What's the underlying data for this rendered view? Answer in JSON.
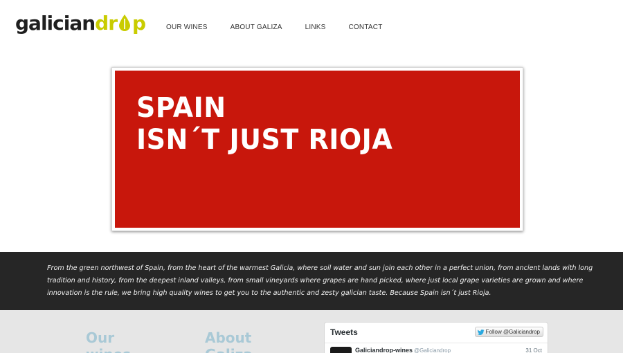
{
  "header": {
    "logo_text_a": "galician",
    "logo_text_b": "dr",
    "logo_text_c": "p",
    "nav": [
      {
        "label": "OUR WINES"
      },
      {
        "label": "ABOUT GALIZA"
      },
      {
        "label": "LINKS"
      },
      {
        "label": "CONTACT"
      }
    ]
  },
  "hero": {
    "line1": "SPAIN",
    "line2": "ISN´T JUST RIOJA"
  },
  "band": {
    "text": "From the green northwest of Spain, from the heart of the warmest Galicia, where soil water and sun join each other in a perfect union, from ancient lands with long tradition and history, from the deepest inland valleys, from small vineyards where grapes are hand picked, where just local grape varieties are grown and where innovation is the rule, we bring high quality wines to get you to the authentic and zesty galician taste. Because Spain isn´t just Rioja."
  },
  "bottom": {
    "wines_title_1": "Our",
    "wines_title_2": "wines",
    "about_title_1": "About",
    "about_title_2": "Galiza"
  },
  "tweets": {
    "header": "Tweets",
    "follow_label": "Follow @Galiciandrop",
    "tweet_name": "Galiciandrop-wines",
    "tweet_handle": "@Galiciandrop",
    "tweet_date": "31 Oct"
  },
  "colors": {
    "hero_red": "#c8170c",
    "logo_accent": "#c9cc00",
    "band_bg": "#262626",
    "column_title": "#a9c9d6"
  }
}
